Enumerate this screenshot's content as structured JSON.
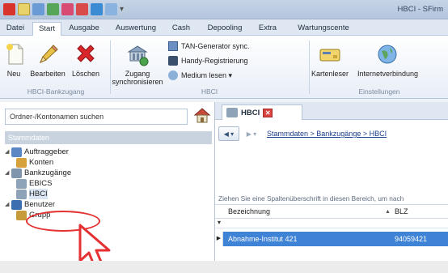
{
  "window": {
    "title": "HBCI - SFirm"
  },
  "ribbon_tabs": [
    {
      "label": "Datei"
    },
    {
      "label": "Start"
    },
    {
      "label": "Ausgabe"
    },
    {
      "label": "Auswertung"
    },
    {
      "label": "Cash"
    },
    {
      "label": "Depooling"
    },
    {
      "label": "Extra"
    },
    {
      "label": "Wartungscente"
    }
  ],
  "ribbon": {
    "group_bankzugang": {
      "label": "HBCI-Bankzugang",
      "neu": "Neu",
      "bearbeiten": "Bearbeiten",
      "loeschen": "Löschen"
    },
    "group_hbci": {
      "label": "HBCI",
      "zugang_line1": "Zugang",
      "zugang_line2": "synchronisieren",
      "tan": "TAN-Generator sync.",
      "handy": "Handy-Registrierung",
      "medium": "Medium lesen ▾"
    },
    "group_einstellungen": {
      "label": "Einstellungen",
      "kartenleser": "Kartenleser",
      "internet": "Internetverbindung"
    }
  },
  "nav": {
    "search_placeholder": "Ordner-/Kontonamen suchen",
    "section": "Stammdaten",
    "tree": [
      {
        "label": "Auftraggeber",
        "level": 0,
        "expanded": true
      },
      {
        "label": "Konten",
        "level": 1
      },
      {
        "label": "Bankzugänge",
        "level": 0,
        "expanded": true
      },
      {
        "label": "EBICS",
        "level": 1
      },
      {
        "label": "HBCI",
        "level": 1,
        "selected": true
      },
      {
        "label": "Benutzer",
        "level": 0,
        "expanded": true
      },
      {
        "label": "Grupp",
        "level": 1
      }
    ]
  },
  "content": {
    "tab_label": "HBCI",
    "breadcrumb": "Stammdaten > Bankzugänge > HBCI",
    "group_hint": "Ziehen Sie eine Spaltenüberschrift in diesen Bereich, um nach",
    "columns": [
      "Bezeichnung",
      "BLZ"
    ],
    "rows": [
      {
        "bezeichnung": "Abnahme-Institut 421",
        "blz": "94059421"
      }
    ]
  },
  "colors": {
    "accent": "#3f83d6",
    "annotation": "#e53131"
  }
}
